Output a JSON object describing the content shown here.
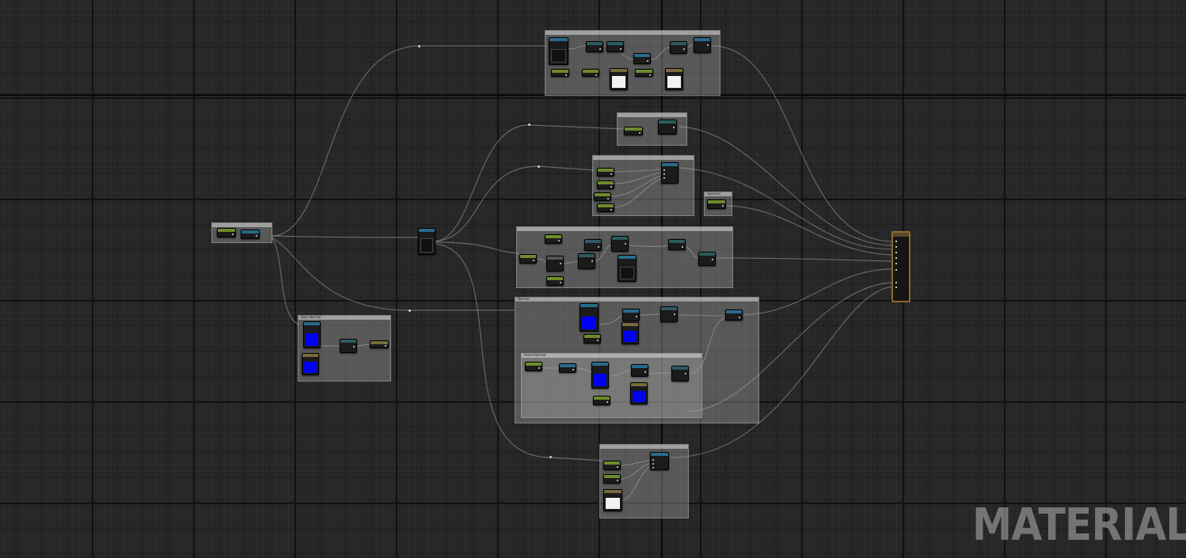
{
  "app": {
    "view": "material-graph-editor"
  },
  "watermark": {
    "text": "MATERIAL"
  },
  "comments": {
    "c_lower_left": "Base Normal",
    "c_middle": "",
    "c_lower_middle": "Normal",
    "c_inner": "Detail Normal",
    "c_small_right": "Specular"
  },
  "colors": {
    "canvas_bg": "#262626",
    "comment_fill": "#aaaaaa",
    "param_header": "#6e8a2c",
    "texture_header": "#2a6a8a",
    "math_header": "#2d5b60",
    "result_border": "#8b6a2a",
    "normal_map_preview": "#0000f5"
  }
}
